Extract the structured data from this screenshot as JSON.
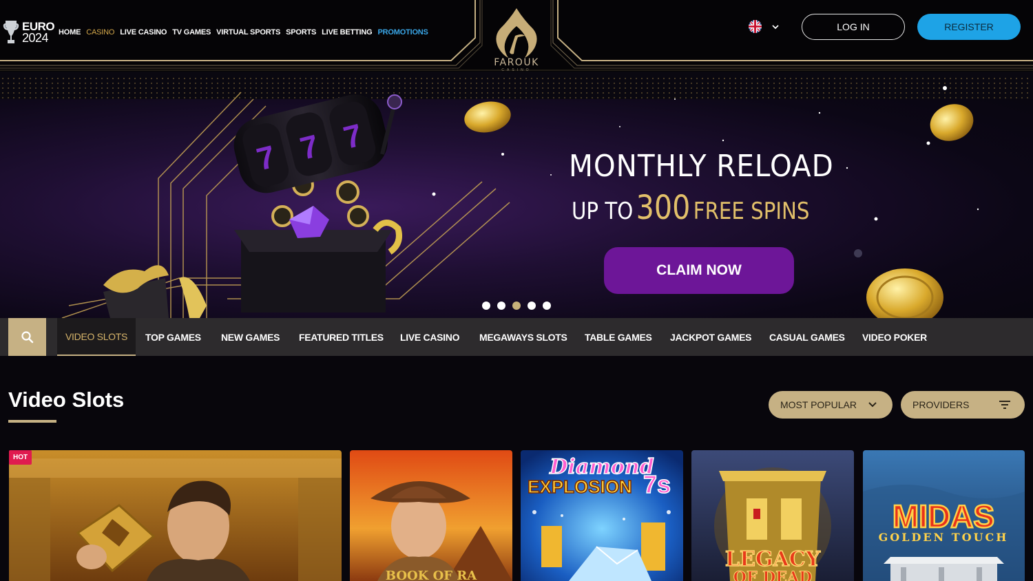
{
  "header": {
    "euro_line1": "EURO",
    "euro_line2": "2024",
    "nav": [
      {
        "label": "HOME",
        "state": "normal"
      },
      {
        "label": "CASINO",
        "state": "active"
      },
      {
        "label": "LIVE CASINO",
        "state": "normal"
      },
      {
        "label": "TV GAMES",
        "state": "normal"
      },
      {
        "label": "VIRTUAL SPORTS",
        "state": "normal"
      },
      {
        "label": "SPORTS",
        "state": "normal"
      },
      {
        "label": "LIVE BETTING",
        "state": "normal"
      },
      {
        "label": "PROMOTIONS",
        "state": "highlight"
      }
    ],
    "logo_name": "FAROUK",
    "logo_sub": "CASINO",
    "language_icon": "uk-flag-icon",
    "login_label": "LOG IN",
    "register_label": "REGISTER"
  },
  "hero": {
    "title": "MONTHLY RELOAD",
    "sub_prefix": "UP TO",
    "sub_number": "300",
    "sub_suffix": "FREE SPINS",
    "cta_label": "CLAIM NOW",
    "slide_count": 5,
    "active_slide": 3
  },
  "categories": {
    "search_icon": "search-icon",
    "items": [
      {
        "label": "VIDEO SLOTS",
        "active": true
      },
      {
        "label": "TOP GAMES",
        "active": false
      },
      {
        "label": "NEW GAMES",
        "active": false
      },
      {
        "label": "FEATURED TITLES",
        "active": false
      },
      {
        "label": "LIVE CASINO",
        "active": false
      },
      {
        "label": "MEGAWAYS SLOTS",
        "active": false
      },
      {
        "label": "TABLE GAMES",
        "active": false
      },
      {
        "label": "JACKPOT GAMES",
        "active": false
      },
      {
        "label": "CASUAL GAMES",
        "active": false
      },
      {
        "label": "VIDEO POKER",
        "active": false
      }
    ]
  },
  "section": {
    "title": "Video Slots",
    "sort_label": "MOST POPULAR",
    "providers_label": "PROVIDERS"
  },
  "games": [
    {
      "title": "",
      "badge": "HOT"
    },
    {
      "title": "BOOK OF RA",
      "badge": ""
    },
    {
      "title": "Diamond Explosion 7s",
      "badge": ""
    },
    {
      "title": "LEGACY OF DEAD",
      "badge": ""
    },
    {
      "title": "MIDAS",
      "subtitle": "GOLDEN TOUCH",
      "badge": ""
    }
  ],
  "colors": {
    "gold": "#c6b184",
    "active_nav": "#d4a84b",
    "promo": "#3aa7e8",
    "register": "#1ea3e6",
    "cta": "#6d1698",
    "hot_badge": "#e01a4f"
  }
}
